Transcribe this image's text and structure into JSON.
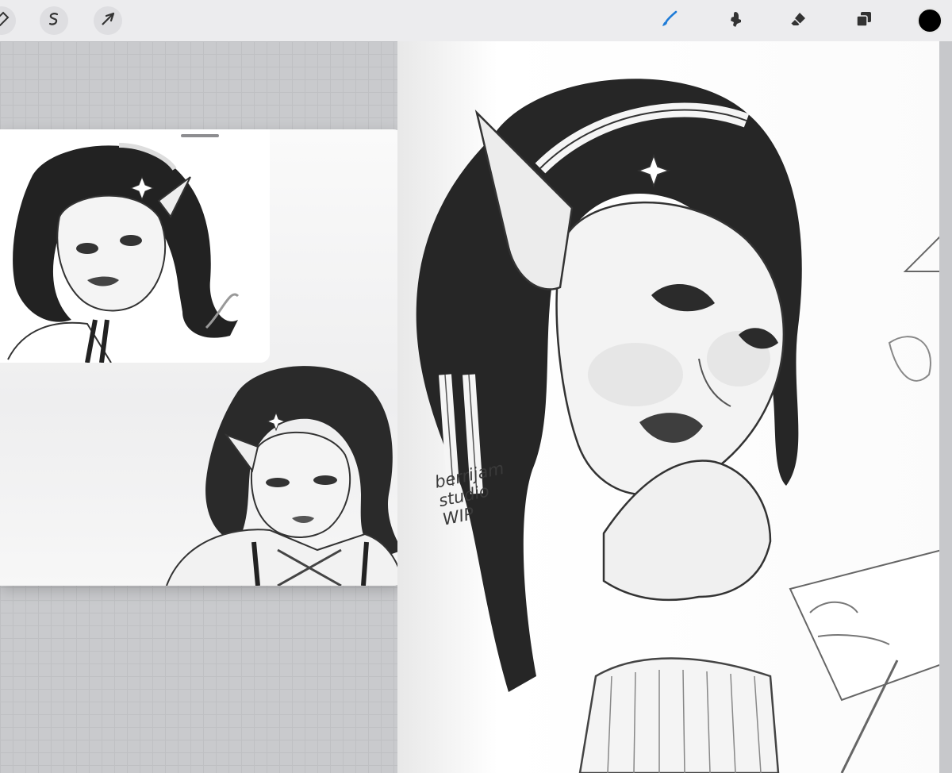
{
  "toolbar": {
    "left_tools": [
      {
        "icon": "modify-icon"
      },
      {
        "icon": "selection-icon"
      },
      {
        "icon": "transform-icon"
      }
    ],
    "right_tools": [
      {
        "icon": "brush-icon",
        "active": true
      },
      {
        "icon": "smudge-icon"
      },
      {
        "icon": "eraser-icon"
      },
      {
        "icon": "layers-icon"
      }
    ],
    "color": "#000000"
  },
  "canvas": {
    "note": "berrijam\nstudio\nWIP"
  },
  "colors": {
    "accent": "#1e7bd7",
    "toolbar_bg": "#ececee",
    "workspace_bg": "#c9cacd"
  }
}
